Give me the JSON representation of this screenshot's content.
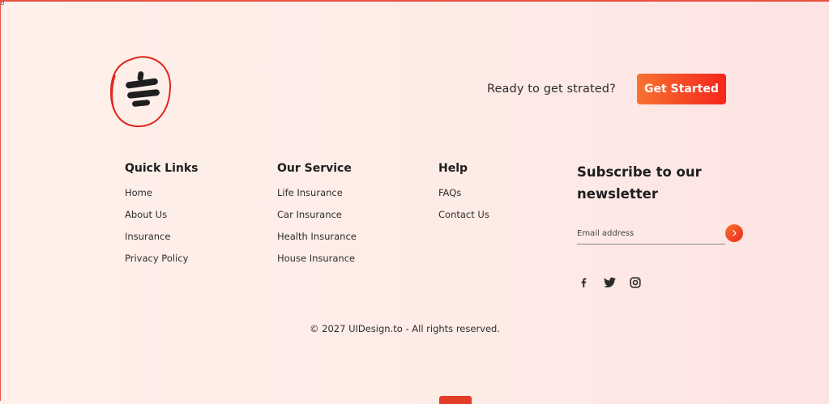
{
  "header": {
    "cta_text": "Ready to get strated?",
    "cta_button_label": "Get Started"
  },
  "quick_links": {
    "title": "Quick Links",
    "items": [
      "Home",
      "About Us",
      "Insurance",
      "Privacy Policy"
    ]
  },
  "our_service": {
    "title": "Our Service",
    "items": [
      "Life Insurance",
      "Car Insurance",
      "Health Insurance",
      "House Insurance"
    ]
  },
  "help": {
    "title": "Help",
    "items": [
      "FAQs",
      "Contact Us"
    ]
  },
  "newsletter": {
    "title": "Subscribe to our newsletter",
    "email_placeholder": "Email address",
    "email_value": ""
  },
  "socials": [
    "facebook-icon",
    "twitter-icon",
    "instagram-icon"
  ],
  "footer": {
    "copyright": "© 2027 UIDesign.to - All rights reserved."
  },
  "colors": {
    "accent_start": "#f7722f",
    "accent_end": "#f5261c",
    "annotation_red": "#e0261c"
  }
}
